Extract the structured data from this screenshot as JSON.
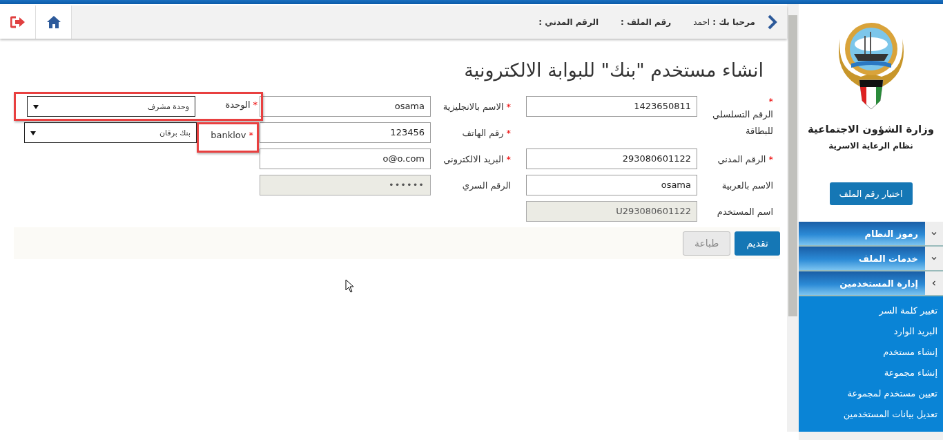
{
  "header": {
    "welcome_label": "مرحبا بك :",
    "user_name": "احمد",
    "file_label": "رقم الملف :",
    "civil_label": "الرقم المدني :"
  },
  "title": "انشاء مستخدم \"بنك\" للبوابة الالكترونية",
  "form": {
    "columns": [
      [
        {
          "kind": "input",
          "label": "الرقم التسلسلي للبطاقة",
          "mark": "*",
          "value": "1423650811",
          "disabled": false
        },
        {
          "kind": "input",
          "label": "الرقم المدني",
          "mark": "*",
          "value": "293080601122",
          "disabled": false
        },
        {
          "kind": "input",
          "label": "الاسم بالعربية",
          "value": "osama",
          "disabled": false
        },
        {
          "kind": "input",
          "label": "اسم المستخدم",
          "value": "U293080601122",
          "disabled": true
        }
      ],
      [
        {
          "kind": "input",
          "label": "الاسم بالانجليزية",
          "mark": "*",
          "value": "osama",
          "disabled": false
        },
        {
          "kind": "input",
          "label": "رقم الهاتف",
          "mark": "*",
          "value": "123456",
          "disabled": false
        },
        {
          "kind": "input",
          "label": "البريد الالكتروني",
          "mark": "*",
          "value": "o@o.com",
          "disabled": false
        },
        {
          "kind": "password",
          "label": "الرقم السري",
          "value": "••••••",
          "disabled": true
        }
      ],
      [
        {
          "kind": "select",
          "label": "الوحدة",
          "mark": "*",
          "value": "وحدة مشرف",
          "highlighted": true
        },
        {
          "kind": "select",
          "label": "banklov",
          "mark": "*",
          "value": "بنك برقان",
          "highlighted": true
        }
      ]
    ]
  },
  "buttons": [
    {
      "label": "تقديم",
      "disabled": false
    },
    {
      "label": "طباعة",
      "disabled": true
    }
  ],
  "sidebar": {
    "ministry": "وزارة الشؤون الاجتماعية",
    "system": "نظام الرعاية الاسرية",
    "file_button": "اختيار رقم الملف",
    "sections": [
      {
        "label": "رموز النظام",
        "expanded": false
      },
      {
        "label": "خدمات الملف",
        "expanded": false
      },
      {
        "label": "إدارة المستخدمين",
        "expanded": true,
        "children": [
          "تغيير كلمة السر",
          "البريد الوارد",
          "إنشاء مستخدم",
          "إنشاء مجموعة",
          "تعيين مستخدم لمجموعة",
          "تعديل بيانات المستخدمين"
        ]
      }
    ]
  }
}
